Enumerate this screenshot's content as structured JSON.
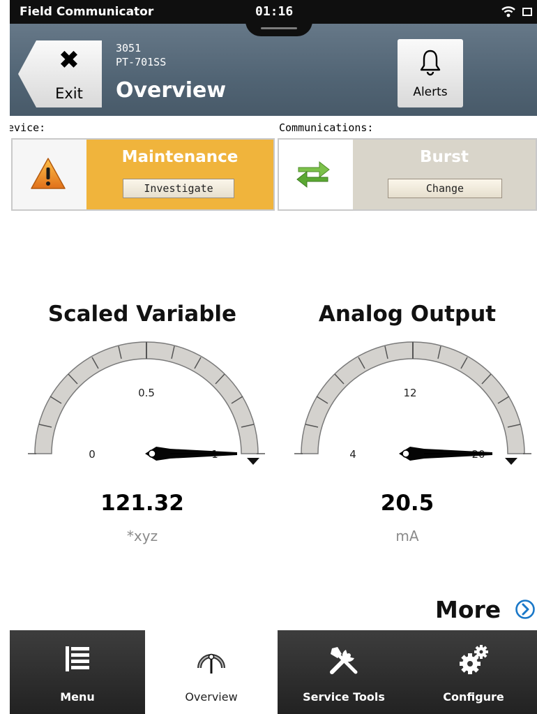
{
  "status_bar": {
    "app_name": "Field Communicator",
    "time": "01:16"
  },
  "header": {
    "exit_label": "Exit",
    "device_model": "3051",
    "device_tag": "PT-701SS",
    "title": "Overview",
    "alerts_label": "Alerts"
  },
  "device_status": {
    "label": "Device:",
    "status": "Maintenance",
    "button": "Investigate",
    "color": "#f0b43c"
  },
  "communications": {
    "label": "Communications:",
    "status": "Burst",
    "button": "Change",
    "color": "#d9d5ca"
  },
  "gauges": [
    {
      "title": "Scaled Variable",
      "min_label": "0",
      "mid_label": "0.5",
      "max_label": "1",
      "value": "121.32",
      "unit": "*xyz"
    },
    {
      "title": "Analog Output",
      "min_label": "4",
      "mid_label": "12",
      "max_label": "20",
      "value": "20.5",
      "unit": "mA"
    }
  ],
  "more_label": "More",
  "bottom_nav": [
    {
      "label": "Menu",
      "icon": "menu-list-icon",
      "active": false
    },
    {
      "label": "Overview",
      "icon": "gauge-icon",
      "active": true
    },
    {
      "label": "Service Tools",
      "icon": "tools-icon",
      "active": false
    },
    {
      "label": "Configure",
      "icon": "gears-icon",
      "active": false
    }
  ]
}
